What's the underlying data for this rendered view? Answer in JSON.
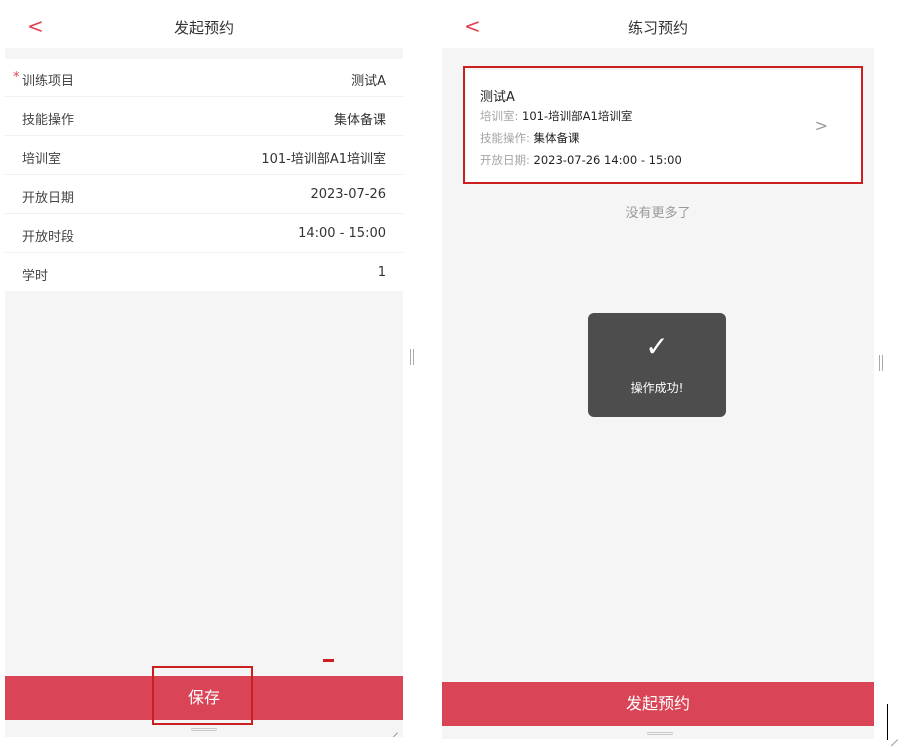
{
  "left_screen": {
    "nav": {
      "back_icon": "<",
      "title": "发起预约"
    },
    "form": {
      "rows": [
        {
          "label": "训练项目",
          "required_mark": "*",
          "value": "测试A"
        },
        {
          "label": "技能操作",
          "value": "集体备课"
        },
        {
          "label": "培训室",
          "value": "101-培训部A1培训室"
        },
        {
          "label": "开放日期",
          "value": "2023-07-26"
        },
        {
          "label": "开放时段",
          "value": "14:00 - 15:00"
        },
        {
          "label": "学时",
          "value": "1"
        }
      ]
    },
    "save_label": "保存"
  },
  "right_screen": {
    "nav": {
      "back_icon": "<",
      "title": "练习预约"
    },
    "card": {
      "title": "测试A",
      "room_key": "培训室:",
      "room_value": "101-培训部A1培训室",
      "skill_key": "技能操作:",
      "skill_value": "集体备课",
      "date_key": "开放日期:",
      "date_value": "2023-07-26 14:00 - 15:00",
      "chevron_icon": ">"
    },
    "no_more": "没有更多了",
    "toast": {
      "check_icon": "✓",
      "message": "操作成功!"
    },
    "submit_label": "发起预约"
  },
  "colors": {
    "accent": "#d94456",
    "back_icon": "#e0424f",
    "highlight_box": "#cc1f1f",
    "toast_bg": "#4d4d4d"
  }
}
